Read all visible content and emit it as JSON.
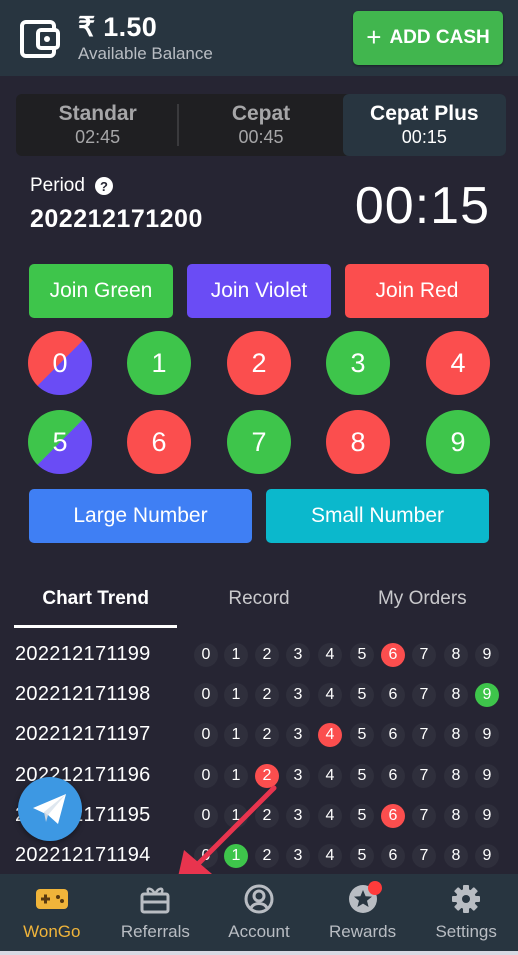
{
  "header": {
    "currency_symbol": "₹",
    "balance": "₹ 1.50",
    "balance_label": "Available Balance",
    "add_cash_label": "ADD CASH",
    "add_cash_icon": "plus-icon",
    "wallet_icon": "wallet-icon"
  },
  "modes": [
    {
      "name": "Standar",
      "time": "02:45",
      "active": false
    },
    {
      "name": "Cepat",
      "time": "00:45",
      "active": false
    },
    {
      "name": "Cepat Plus",
      "time": "00:15",
      "active": true
    }
  ],
  "period": {
    "label": "Period",
    "help_icon": "?",
    "number": "202212171200",
    "countdown": "00:15"
  },
  "join_buttons": {
    "green": "Join Green",
    "violet": "Join Violet",
    "red": "Join Red"
  },
  "numbers": [
    {
      "value": "0",
      "color": "red-violet"
    },
    {
      "value": "1",
      "color": "green"
    },
    {
      "value": "2",
      "color": "red"
    },
    {
      "value": "3",
      "color": "green"
    },
    {
      "value": "4",
      "color": "red"
    },
    {
      "value": "5",
      "color": "green-violet"
    },
    {
      "value": "6",
      "color": "red"
    },
    {
      "value": "7",
      "color": "green"
    },
    {
      "value": "8",
      "color": "red"
    },
    {
      "value": "9",
      "color": "green"
    }
  ],
  "size_buttons": {
    "large": "Large Number",
    "small": "Small Number"
  },
  "tabs": [
    {
      "label": "Chart Trend",
      "active": true
    },
    {
      "label": "Record",
      "active": false
    },
    {
      "label": "My Orders",
      "active": false
    }
  ],
  "trend": {
    "digits": [
      "0",
      "1",
      "2",
      "3",
      "4",
      "5",
      "6",
      "7",
      "8",
      "9"
    ],
    "rows": [
      {
        "period": "202212171199",
        "hit": 6,
        "hit_color": "red"
      },
      {
        "period": "202212171198",
        "hit": 9,
        "hit_color": "green"
      },
      {
        "period": "202212171197",
        "hit": 4,
        "hit_color": "red"
      },
      {
        "period": "202212171196",
        "hit": 2,
        "hit_color": "red"
      },
      {
        "period": "202212171195",
        "hit": 6,
        "hit_color": "red"
      },
      {
        "period": "202212171194",
        "hit": 1,
        "hit_color": "green"
      }
    ]
  },
  "colors": {
    "green": "#3ec54b",
    "violet": "#6a4cf5",
    "red": "#fb4e4e",
    "blue": "#3f7ff4",
    "cyan": "#0bb8cc",
    "nav_active": "#f0b43a",
    "annotation_arrow": "#e8344e"
  },
  "bottom_nav": [
    {
      "label": "WonGo",
      "icon": "gamepad-icon",
      "active": true
    },
    {
      "label": "Referrals",
      "icon": "gift-icon",
      "active": false
    },
    {
      "label": "Account",
      "icon": "account-icon",
      "active": false
    },
    {
      "label": "Rewards",
      "icon": "star-badge-icon",
      "active": false,
      "notification": true
    },
    {
      "label": "Settings",
      "icon": "gear-icon",
      "active": false
    }
  ]
}
